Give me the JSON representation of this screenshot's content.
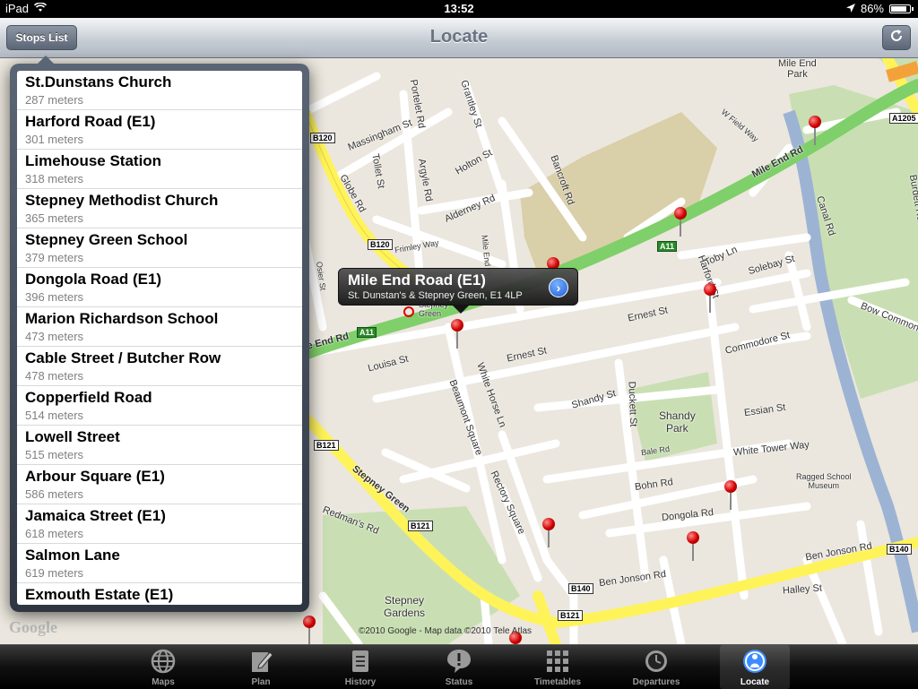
{
  "status_bar": {
    "device": "iPad",
    "time": "13:52",
    "battery": "86%",
    "battery_level": 0.86
  },
  "nav_bar": {
    "title": "Locate",
    "stops_list_label": "Stops List",
    "refresh_icon": "refresh-icon"
  },
  "stops": [
    {
      "name": "St.Dunstans Church",
      "distance": "287 meters"
    },
    {
      "name": "Harford Road (E1)",
      "distance": "301 meters"
    },
    {
      "name": "Limehouse Station",
      "distance": "318 meters"
    },
    {
      "name": "Stepney Methodist Church",
      "distance": "365 meters"
    },
    {
      "name": "Stepney Green School",
      "distance": "379 meters"
    },
    {
      "name": "Dongola Road (E1)",
      "distance": "396 meters"
    },
    {
      "name": "Marion Richardson School",
      "distance": "473 meters"
    },
    {
      "name": "Cable Street / Butcher Row",
      "distance": "478 meters"
    },
    {
      "name": "Copperfield Road",
      "distance": "514 meters"
    },
    {
      "name": "Lowell Street",
      "distance": "515 meters"
    },
    {
      "name": "Arbour Square (E1)",
      "distance": "586 meters"
    },
    {
      "name": "Jamaica Street (E1)",
      "distance": "618 meters"
    },
    {
      "name": "Salmon Lane",
      "distance": "619 meters"
    },
    {
      "name": "Exmouth Estate (E1)",
      "distance": ""
    }
  ],
  "callout": {
    "title": "Mile End Road (E1)",
    "subtitle": "St. Dunstan's & Stepney Green, E1  4LP"
  },
  "map": {
    "labels": {
      "mile_end_rd": "Mile End Rd",
      "mile_end_rd_west": "e End Rd",
      "mile_end_park": "Mile End\nPark",
      "globe_rd": "Globe Rd",
      "portelet_rd": "Portelet Rd",
      "grantley_st": "Grantley St",
      "massingham_st": "Massingham St",
      "toller_st": "Tollet St",
      "argyle_rd": "Argyle Rd",
      "holton_st": "Holton St",
      "bancroft_rd": "Bancroft Rd",
      "alderney_rd": "Alderney Rd",
      "ernest_st": "Ernest St",
      "louisa_st": "Louisa St",
      "white_horse_ln": "White Horse Ln",
      "beaumont_square": "Beaumont Square",
      "commodore_st": "Commodore St",
      "shandy_st": "Shandy St",
      "shandy_park": "Shandy\nPark",
      "essian_st": "Essian St",
      "white_tower_way": "White Tower Way",
      "duckett_st": "Duckett St",
      "bale_rd": "Bale Rd",
      "bohn_rd": "Bohn Rd",
      "dongola_rd": "Dongola Rd",
      "ben_jonson_rd": "Ben Jonson Rd",
      "ben_jonson_rd_east": "Ben Jonson Rd",
      "halley_st": "Halley St",
      "stepney_green": "Stepney Green",
      "rectory_square": "Rectory Square",
      "stepney_gardens": "Stepney\nGardens",
      "redmans_rd": "Redman's Rd",
      "toby_ln": "Toby Ln",
      "solebay_st": "Solebay St",
      "harford_st": "Harford St",
      "canal_rd": "Canal Rd",
      "bow_common": "Bow Common",
      "burdett_rd": "Burdett Rd",
      "ragged_school": "Ragged School\nMuseum",
      "stepney_green_stn": "Stepney\nGreen",
      "osier_st": "Osier St",
      "mile_end_pl": "Mile End Pl",
      "frimley_way": "Frimley Way",
      "w_field_way": "W Field Way"
    },
    "shields": {
      "b120a": "B120",
      "b120b": "B120",
      "a11a": "A11",
      "a11b": "A11",
      "b121a": "B121",
      "b121b": "B121",
      "b121c": "B121",
      "b140a": "B140",
      "b140b": "B140",
      "a1205": "A1205"
    },
    "attribution": "©2010 Google - Map data ©2010 Tele Atlas",
    "logo": "Google"
  },
  "tabs": [
    {
      "label": "Maps",
      "icon": "globe-icon"
    },
    {
      "label": "Plan",
      "icon": "pencil-icon"
    },
    {
      "label": "History",
      "icon": "document-icon"
    },
    {
      "label": "Status",
      "icon": "alert-icon"
    },
    {
      "label": "Timetables",
      "icon": "grid-icon"
    },
    {
      "label": "Departures",
      "icon": "clock-icon"
    },
    {
      "label": "Locate",
      "icon": "locate-icon"
    }
  ],
  "selected_tab": "Locate"
}
